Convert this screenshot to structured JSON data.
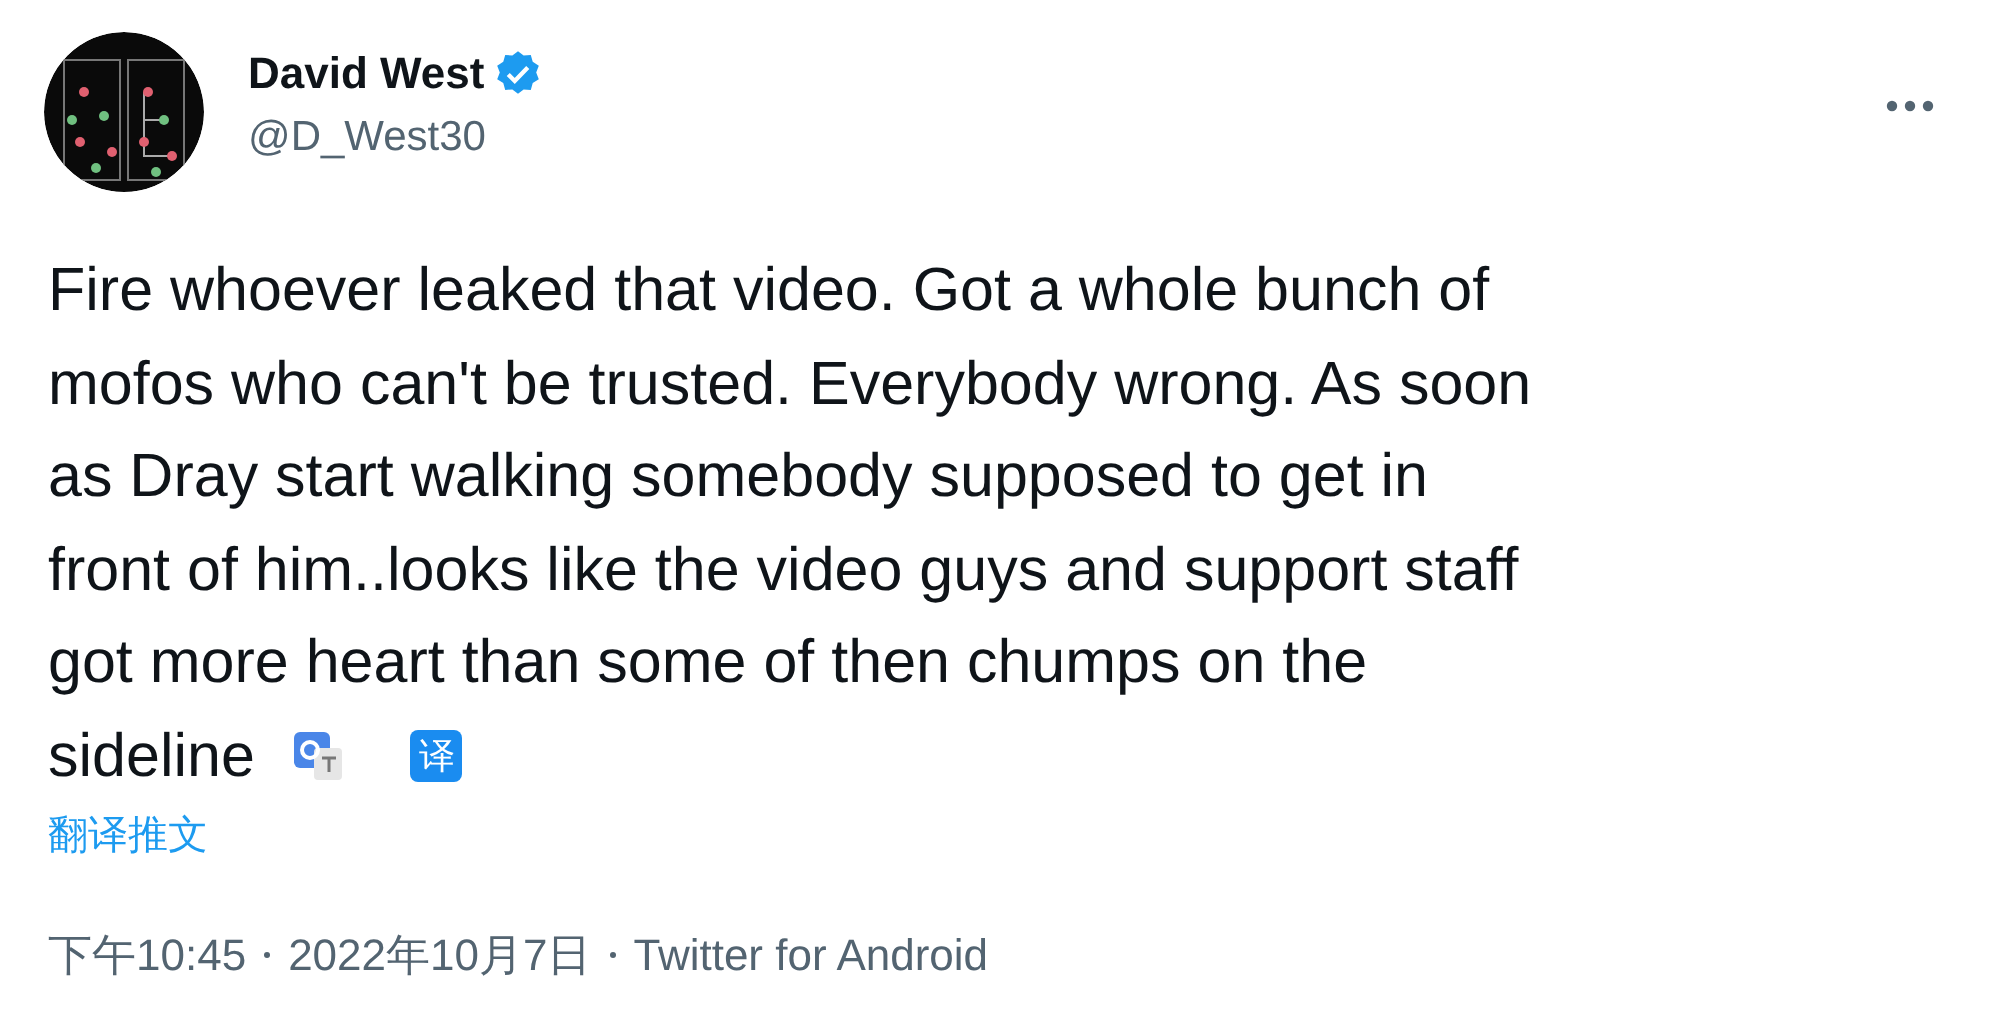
{
  "author": {
    "name": "David West",
    "verified": true,
    "handle": "@D_West30"
  },
  "tweet": {
    "lines": [
      "Fire whoever leaked that video. Got a whole bunch of",
      "mofos who can't be trusted. Everybody wrong. As soon",
      "as Dray start walking somebody supposed to get in",
      "front of him..looks like the video guys and support staff",
      "got more heart than some of then chumps on the",
      "sideline"
    ],
    "translate_badge": "译"
  },
  "translate_link": "翻译推文",
  "meta": {
    "time": "下午10:45",
    "date": "2022年10月7日",
    "source": "Twitter for Android"
  }
}
